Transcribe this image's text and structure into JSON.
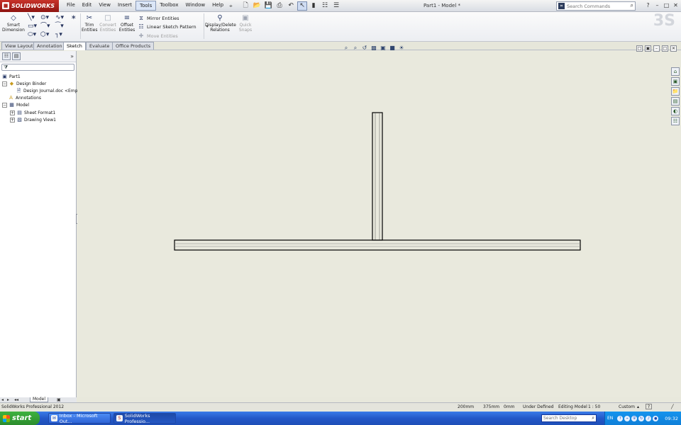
{
  "app": {
    "brand": "SOLIDWORKS",
    "doc_title": "Part1 - Model *",
    "menus": [
      "File",
      "Edit",
      "View",
      "Insert",
      "Tools",
      "Toolbox",
      "Window",
      "Help"
    ],
    "active_menu": "Tools",
    "search_placeholder": "Search Commands"
  },
  "command_manager": {
    "smart_dimension": "Smart Dimension",
    "trim": "Trim Entities",
    "convert": "Convert Entities",
    "offset": "Offset Entities",
    "mirror": "Mirror Entities",
    "linear_pattern": "Linear Sketch Pattern",
    "move": "Move Entities",
    "relations": "Display/Delete Relations",
    "quick_snaps": "Quick Snaps"
  },
  "tabs": [
    {
      "label": "View Layout"
    },
    {
      "label": "Annotation"
    },
    {
      "label": "Sketch",
      "active": true
    },
    {
      "label": "Evaluate"
    },
    {
      "label": "Office Products"
    }
  ],
  "feature_tree": {
    "items": [
      {
        "label": "Part1"
      },
      {
        "label": "Design Binder"
      },
      {
        "label": "Design Journal.doc <Emp"
      },
      {
        "label": "Annotations"
      },
      {
        "label": "Model"
      },
      {
        "label": "Sheet Format1"
      },
      {
        "label": "Drawing View1"
      }
    ],
    "bottom_tab": "Model"
  },
  "status_bar": {
    "product": "SolidWorks Professional 2012",
    "x": "200mm",
    "y": "375mm",
    "z": "0mm",
    "state": "Under Defined",
    "mode": "Editing Model",
    "scale": "1 : 50",
    "units": "Custom"
  },
  "taskbar": {
    "start_label": "start",
    "items": [
      {
        "label": "Inbox - Microsoft Out..."
      },
      {
        "label": "SolidWorks Professio..."
      }
    ],
    "search_placeholder": "Search Desktop",
    "lang": "EN",
    "clock": "09:32"
  },
  "colors": {
    "canvas": "#e9e9dd",
    "sketch_line": "#000000",
    "brand_red": "#b02a22",
    "taskbar": "#2458c8"
  }
}
